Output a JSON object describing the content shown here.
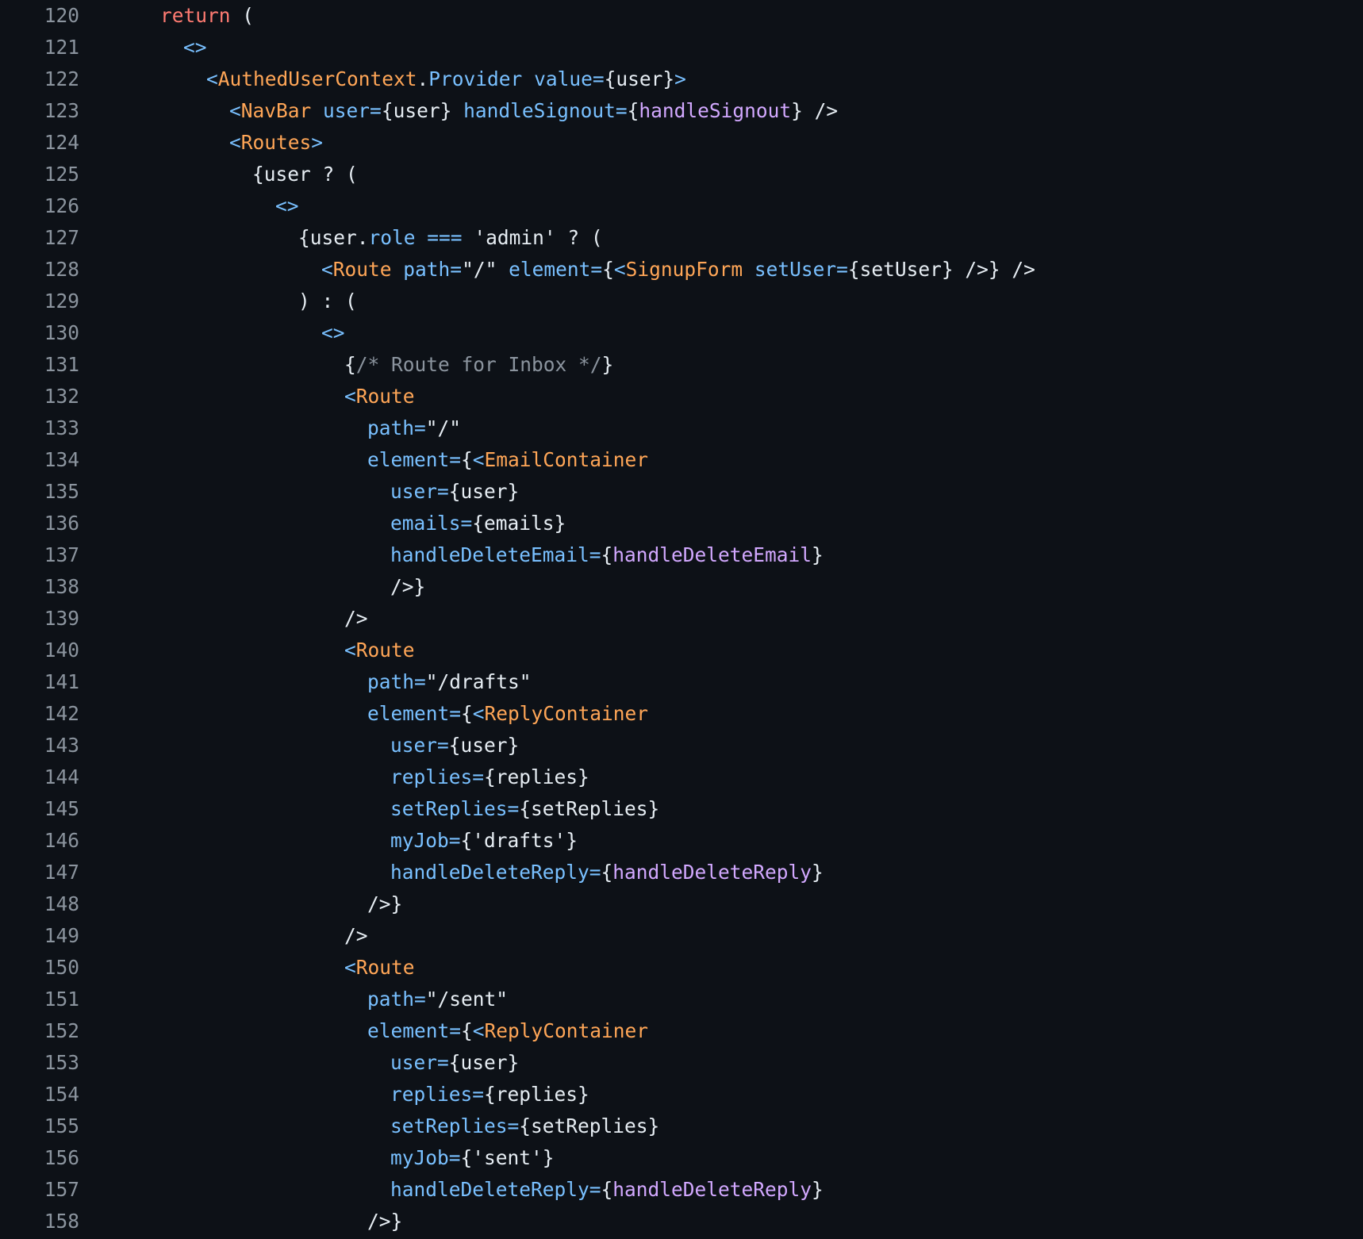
{
  "editor": {
    "theme": {
      "background": "#0d1117",
      "text": "#e6edf3",
      "line_number": "#8b949e",
      "keyword": "#ff7b72",
      "component": "#ffa657",
      "attribute": "#79c0ff",
      "function": "#d2a8ff",
      "string": "#a5d6ff",
      "comment": "#8b949e"
    },
    "lines": [
      {
        "n": "120",
        "indent": 0,
        "tokens": [
          [
            "kw",
            "return"
          ],
          [
            "pun",
            " ("
          ]
        ]
      },
      {
        "n": "121",
        "indent": 1,
        "tokens": [
          [
            "br",
            "<>"
          ]
        ]
      },
      {
        "n": "122",
        "indent": 2,
        "tokens": [
          [
            "br",
            "<"
          ],
          [
            "tag",
            "AuthedUserContext"
          ],
          [
            "pun",
            "."
          ],
          [
            "at",
            "Provider"
          ],
          [
            "pun",
            " "
          ],
          [
            "at",
            "value="
          ],
          [
            "pun",
            "{user}"
          ],
          [
            "br",
            ">"
          ]
        ]
      },
      {
        "n": "123",
        "indent": 3,
        "tokens": [
          [
            "br",
            "<"
          ],
          [
            "tag",
            "NavBar"
          ],
          [
            "pun",
            " "
          ],
          [
            "at",
            "user="
          ],
          [
            "pun",
            "{user} "
          ],
          [
            "at",
            "handleSignout="
          ],
          [
            "pun",
            "{"
          ],
          [
            "fn",
            "handleSignout"
          ],
          [
            "pun",
            "} />"
          ]
        ]
      },
      {
        "n": "124",
        "indent": 3,
        "tokens": [
          [
            "br",
            "<"
          ],
          [
            "tag",
            "Routes"
          ],
          [
            "br",
            ">"
          ]
        ]
      },
      {
        "n": "125",
        "indent": 4,
        "tokens": [
          [
            "pun",
            "{user ? ("
          ]
        ]
      },
      {
        "n": "126",
        "indent": 5,
        "tokens": [
          [
            "br",
            "<>"
          ]
        ]
      },
      {
        "n": "127",
        "indent": 6,
        "tokens": [
          [
            "pun",
            "{user."
          ],
          [
            "at",
            "role"
          ],
          [
            "pun",
            " "
          ],
          [
            "at",
            "==="
          ],
          [
            "pun",
            " 'admin' ? ("
          ]
        ]
      },
      {
        "n": "128",
        "indent": 7,
        "tokens": [
          [
            "br",
            "<"
          ],
          [
            "tag",
            "Route"
          ],
          [
            "pun",
            " "
          ],
          [
            "at",
            "path="
          ],
          [
            "pun",
            "\"/\" "
          ],
          [
            "at",
            "element="
          ],
          [
            "pun",
            "{"
          ],
          [
            "br",
            "<"
          ],
          [
            "tag",
            "SignupForm"
          ],
          [
            "pun",
            " "
          ],
          [
            "at",
            "setUser="
          ],
          [
            "pun",
            "{setUser} />} />"
          ]
        ]
      },
      {
        "n": "129",
        "indent": 6,
        "tokens": [
          [
            "pun",
            ") : ("
          ]
        ]
      },
      {
        "n": "130",
        "indent": 7,
        "tokens": [
          [
            "br",
            "<>"
          ]
        ]
      },
      {
        "n": "131",
        "indent": 8,
        "tokens": [
          [
            "pun",
            "{"
          ],
          [
            "cm",
            "/* Route for Inbox */"
          ],
          [
            "pun",
            "}"
          ]
        ]
      },
      {
        "n": "132",
        "indent": 8,
        "tokens": [
          [
            "br",
            "<"
          ],
          [
            "tag",
            "Route"
          ]
        ]
      },
      {
        "n": "133",
        "indent": 9,
        "tokens": [
          [
            "at",
            "path="
          ],
          [
            "pun",
            "\"/\""
          ]
        ]
      },
      {
        "n": "134",
        "indent": 9,
        "tokens": [
          [
            "at",
            "element="
          ],
          [
            "pun",
            "{"
          ],
          [
            "br",
            "<"
          ],
          [
            "tag",
            "EmailContainer"
          ]
        ]
      },
      {
        "n": "135",
        "indent": 10,
        "tokens": [
          [
            "at",
            "user="
          ],
          [
            "pun",
            "{user}"
          ]
        ]
      },
      {
        "n": "136",
        "indent": 10,
        "tokens": [
          [
            "at",
            "emails="
          ],
          [
            "pun",
            "{emails}"
          ]
        ]
      },
      {
        "n": "137",
        "indent": 10,
        "tokens": [
          [
            "at",
            "handleDeleteEmail="
          ],
          [
            "pun",
            "{"
          ],
          [
            "fn",
            "handleDeleteEmail"
          ],
          [
            "pun",
            "}"
          ]
        ]
      },
      {
        "n": "138",
        "indent": 10,
        "tokens": [
          [
            "pun",
            "/>}"
          ]
        ]
      },
      {
        "n": "139",
        "indent": 8,
        "tokens": [
          [
            "pun",
            "/>"
          ]
        ]
      },
      {
        "n": "140",
        "indent": 8,
        "tokens": [
          [
            "br",
            "<"
          ],
          [
            "tag",
            "Route"
          ]
        ]
      },
      {
        "n": "141",
        "indent": 9,
        "tokens": [
          [
            "at",
            "path="
          ],
          [
            "pun",
            "\"/drafts\""
          ]
        ]
      },
      {
        "n": "142",
        "indent": 9,
        "tokens": [
          [
            "at",
            "element="
          ],
          [
            "pun",
            "{"
          ],
          [
            "br",
            "<"
          ],
          [
            "tag",
            "ReplyContainer"
          ]
        ]
      },
      {
        "n": "143",
        "indent": 10,
        "tokens": [
          [
            "at",
            "user="
          ],
          [
            "pun",
            "{user}"
          ]
        ]
      },
      {
        "n": "144",
        "indent": 10,
        "tokens": [
          [
            "at",
            "replies="
          ],
          [
            "pun",
            "{replies}"
          ]
        ]
      },
      {
        "n": "145",
        "indent": 10,
        "tokens": [
          [
            "at",
            "setReplies="
          ],
          [
            "pun",
            "{setReplies}"
          ]
        ]
      },
      {
        "n": "146",
        "indent": 10,
        "tokens": [
          [
            "at",
            "myJob="
          ],
          [
            "pun",
            "{'drafts'}"
          ]
        ]
      },
      {
        "n": "147",
        "indent": 10,
        "tokens": [
          [
            "at",
            "handleDeleteReply="
          ],
          [
            "pun",
            "{"
          ],
          [
            "fn",
            "handleDeleteReply"
          ],
          [
            "pun",
            "}"
          ]
        ]
      },
      {
        "n": "148",
        "indent": 9,
        "tokens": [
          [
            "pun",
            "/>}"
          ]
        ]
      },
      {
        "n": "149",
        "indent": 8,
        "tokens": [
          [
            "pun",
            "/>"
          ]
        ]
      },
      {
        "n": "150",
        "indent": 8,
        "tokens": [
          [
            "br",
            "<"
          ],
          [
            "tag",
            "Route"
          ]
        ]
      },
      {
        "n": "151",
        "indent": 9,
        "tokens": [
          [
            "at",
            "path="
          ],
          [
            "pun",
            "\"/sent\""
          ]
        ]
      },
      {
        "n": "152",
        "indent": 9,
        "tokens": [
          [
            "at",
            "element="
          ],
          [
            "pun",
            "{"
          ],
          [
            "br",
            "<"
          ],
          [
            "tag",
            "ReplyContainer"
          ]
        ]
      },
      {
        "n": "153",
        "indent": 10,
        "tokens": [
          [
            "at",
            "user="
          ],
          [
            "pun",
            "{user}"
          ]
        ]
      },
      {
        "n": "154",
        "indent": 10,
        "tokens": [
          [
            "at",
            "replies="
          ],
          [
            "pun",
            "{replies}"
          ]
        ]
      },
      {
        "n": "155",
        "indent": 10,
        "tokens": [
          [
            "at",
            "setReplies="
          ],
          [
            "pun",
            "{setReplies}"
          ]
        ]
      },
      {
        "n": "156",
        "indent": 10,
        "tokens": [
          [
            "at",
            "myJob="
          ],
          [
            "pun",
            "{'sent'}"
          ]
        ]
      },
      {
        "n": "157",
        "indent": 10,
        "tokens": [
          [
            "at",
            "handleDeleteReply="
          ],
          [
            "pun",
            "{"
          ],
          [
            "fn",
            "handleDeleteReply"
          ],
          [
            "pun",
            "}"
          ]
        ]
      },
      {
        "n": "158",
        "indent": 9,
        "tokens": [
          [
            "pun",
            "/>}"
          ]
        ]
      }
    ]
  }
}
